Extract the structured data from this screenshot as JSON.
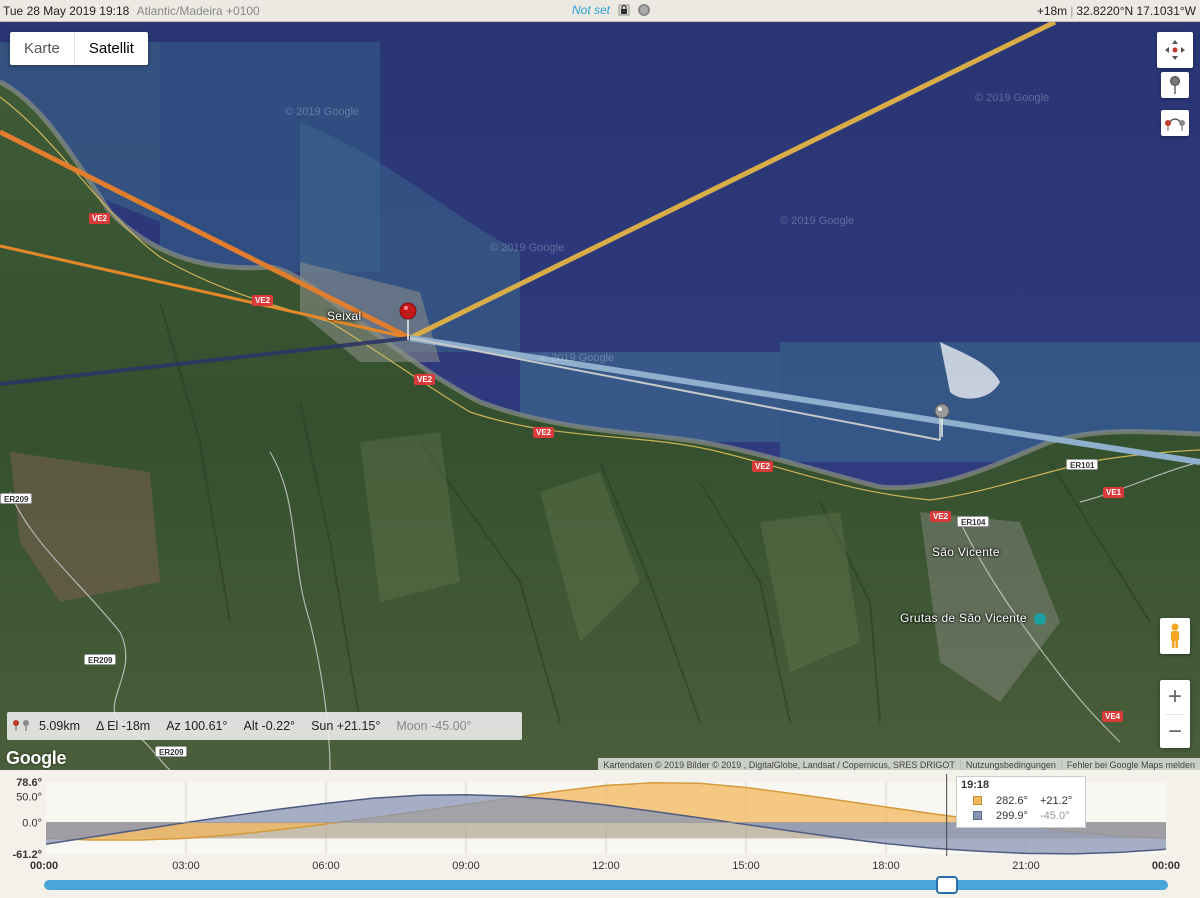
{
  "topbar": {
    "datetime": "Tue 28 May 2019 19:18",
    "timezone": "Atlantic/Madeira +0100",
    "status": "Not set",
    "elevation": "+18m",
    "coords": "32.8220°N 17.1031°W"
  },
  "maptype": {
    "map_label": "Karte",
    "satellite_label": "Satellit",
    "active": "Satellit"
  },
  "places": {
    "town1": "Seixal",
    "town2": "São Vicente",
    "poi": "Grutas de São Vicente"
  },
  "roads": [
    "VE2",
    "VE2",
    "VE2",
    "VE2",
    "VE2",
    "VE2",
    "ER101",
    "VE1",
    "ER104",
    "ER209",
    "ER209",
    "VE4",
    "ER209"
  ],
  "watermark": "© 2019 Google",
  "info": {
    "distance": "5.09km",
    "delta_el": "Δ El  -18m",
    "azimuth": "Az 100.61°",
    "altitude": "Alt  -0.22°",
    "sun": "Sun +21.15°",
    "moon": "Moon -45.00°"
  },
  "logo": "Google",
  "attribution": {
    "data": "Kartendaten © 2019 Bilder © 2019 , DigitalGlobe, Landsat / Copernicus, SRES DRIGOT",
    "terms": "Nutzungsbedingungen",
    "report": "Fehler bei Google Maps melden"
  },
  "zoom": {
    "in": "+",
    "out": "−"
  },
  "chart_data": {
    "type": "area",
    "x_ticks": [
      "00:00",
      "03:00",
      "06:00",
      "09:00",
      "12:00",
      "15:00",
      "18:00",
      "21:00",
      "00:00"
    ],
    "y_ticks": [
      "78.6°",
      "50.0°",
      "0.0°",
      "-61.2°"
    ],
    "ylim": [
      -61.2,
      78.6
    ],
    "series": [
      {
        "name": "Sun",
        "color": "#f1b75d",
        "x": [
          0,
          1,
          2,
          3,
          4,
          5,
          6,
          7,
          8,
          9,
          10,
          11,
          12,
          13,
          14,
          15,
          16,
          17,
          18,
          19,
          20,
          21,
          22,
          23,
          24
        ],
        "values": [
          -31,
          -34,
          -34,
          -31,
          -24,
          -14,
          -3,
          9,
          22,
          35,
          48,
          61,
          72,
          77,
          76,
          68,
          56,
          43,
          30,
          17,
          5,
          -7,
          -18,
          -26,
          -31
        ]
      },
      {
        "name": "Moon",
        "color": "#8895b5",
        "x": [
          0,
          1,
          2,
          3,
          4,
          5,
          6,
          7,
          8,
          9,
          10,
          11,
          12,
          13,
          14,
          15,
          16,
          17,
          18,
          19,
          20,
          21,
          22,
          23,
          24
        ],
        "values": [
          -42,
          -28,
          -14,
          0,
          13,
          26,
          37,
          47,
          53,
          54,
          51,
          44,
          34,
          22,
          9,
          -4,
          -17,
          -30,
          -41,
          -50,
          -56,
          -60,
          -61,
          -58,
          -52
        ]
      }
    ],
    "cursor": {
      "time": "19:18",
      "sun_az": "282.6°",
      "sun_alt": "+21.2°",
      "moon_az": "299.9°",
      "moon_alt": "-45.0°"
    }
  }
}
